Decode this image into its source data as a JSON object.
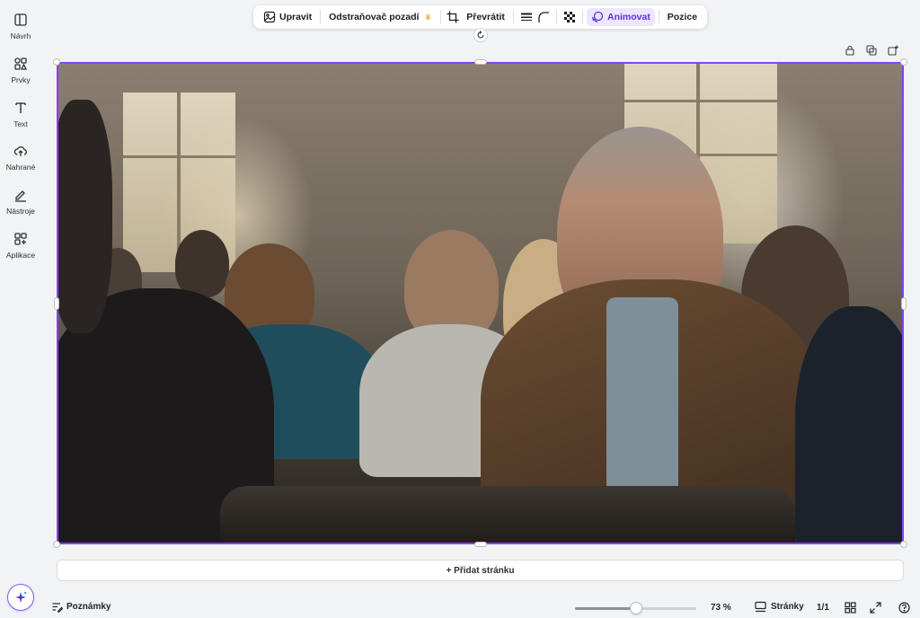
{
  "sidebar": {
    "items": [
      {
        "label": "Návrh",
        "icon": "layout-icon"
      },
      {
        "label": "Prvky",
        "icon": "elements-icon"
      },
      {
        "label": "Text",
        "icon": "text-icon"
      },
      {
        "label": "Nahrané",
        "icon": "upload-cloud-icon"
      },
      {
        "label": "Nástroje",
        "icon": "pen-tool-icon"
      },
      {
        "label": "Aplikace",
        "icon": "apps-grid-icon"
      }
    ]
  },
  "toolbar": {
    "edit_label": "Upravit",
    "bg_remover_label": "Odstraňovač pozadí",
    "premium_badge": "♛",
    "flip_label": "Převrátit",
    "animate_label": "Animovat",
    "position_label": "Pozice"
  },
  "canvas": {
    "add_page_label": "+ Přidat stránku"
  },
  "footer": {
    "notes_label": "Poznámky",
    "zoom_label": "73 %",
    "zoom_value": 0.5,
    "pages_label": "Stránky",
    "page_count": "1/1"
  },
  "colors": {
    "accent": "#8b3dff",
    "accent_soft": "#ece7ff",
    "premium": "#f2a516"
  }
}
